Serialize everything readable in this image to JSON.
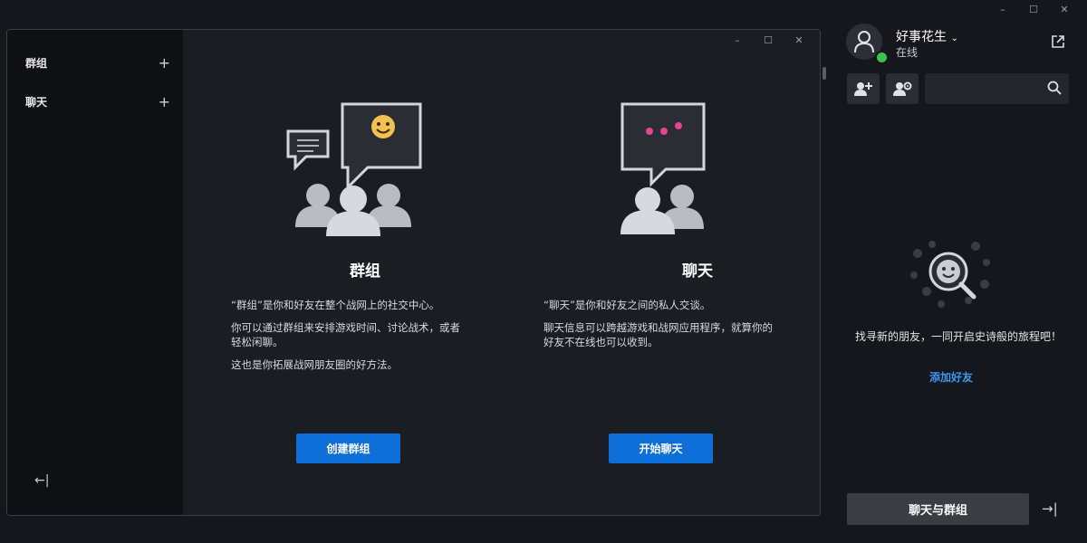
{
  "window": {
    "minimize": "–",
    "maximize": "☐",
    "close": "✕"
  },
  "sidebar": {
    "items": [
      {
        "label": "群组",
        "add": "+"
      },
      {
        "label": "聊天",
        "add": "+"
      }
    ],
    "collapse_icon": "←|"
  },
  "panels": {
    "groups": {
      "title": "群组",
      "paragraphs": [
        "“群组”是你和好友在整个战网上的社交中心。",
        "你可以通过群组来安排游戏时间、讨论战术，或者轻松闲聊。",
        "这也是你拓展战网朋友圈的好方法。"
      ],
      "button": "创建群组"
    },
    "chat": {
      "title": "聊天",
      "paragraphs": [
        "“聊天”是你和好友之间的私人交谈。",
        "聊天信息可以跨越游戏和战网应用程序，就算你的好友不在线也可以收到。"
      ],
      "button": "开始聊天"
    }
  },
  "friends": {
    "username": "好事花生",
    "status": "在线",
    "search_placeholder": "",
    "empty_text": "找寻新的朋友，一同开启史诗般的旅程吧！",
    "add_friend": "添加好友",
    "bottom_button": "聊天与群组"
  },
  "colors": {
    "accent": "#0f6fd8",
    "link": "#3b97f0",
    "online": "#3ac34a",
    "emoji_yellow": "#f2c14e",
    "typing_dots": "#e2468f"
  }
}
